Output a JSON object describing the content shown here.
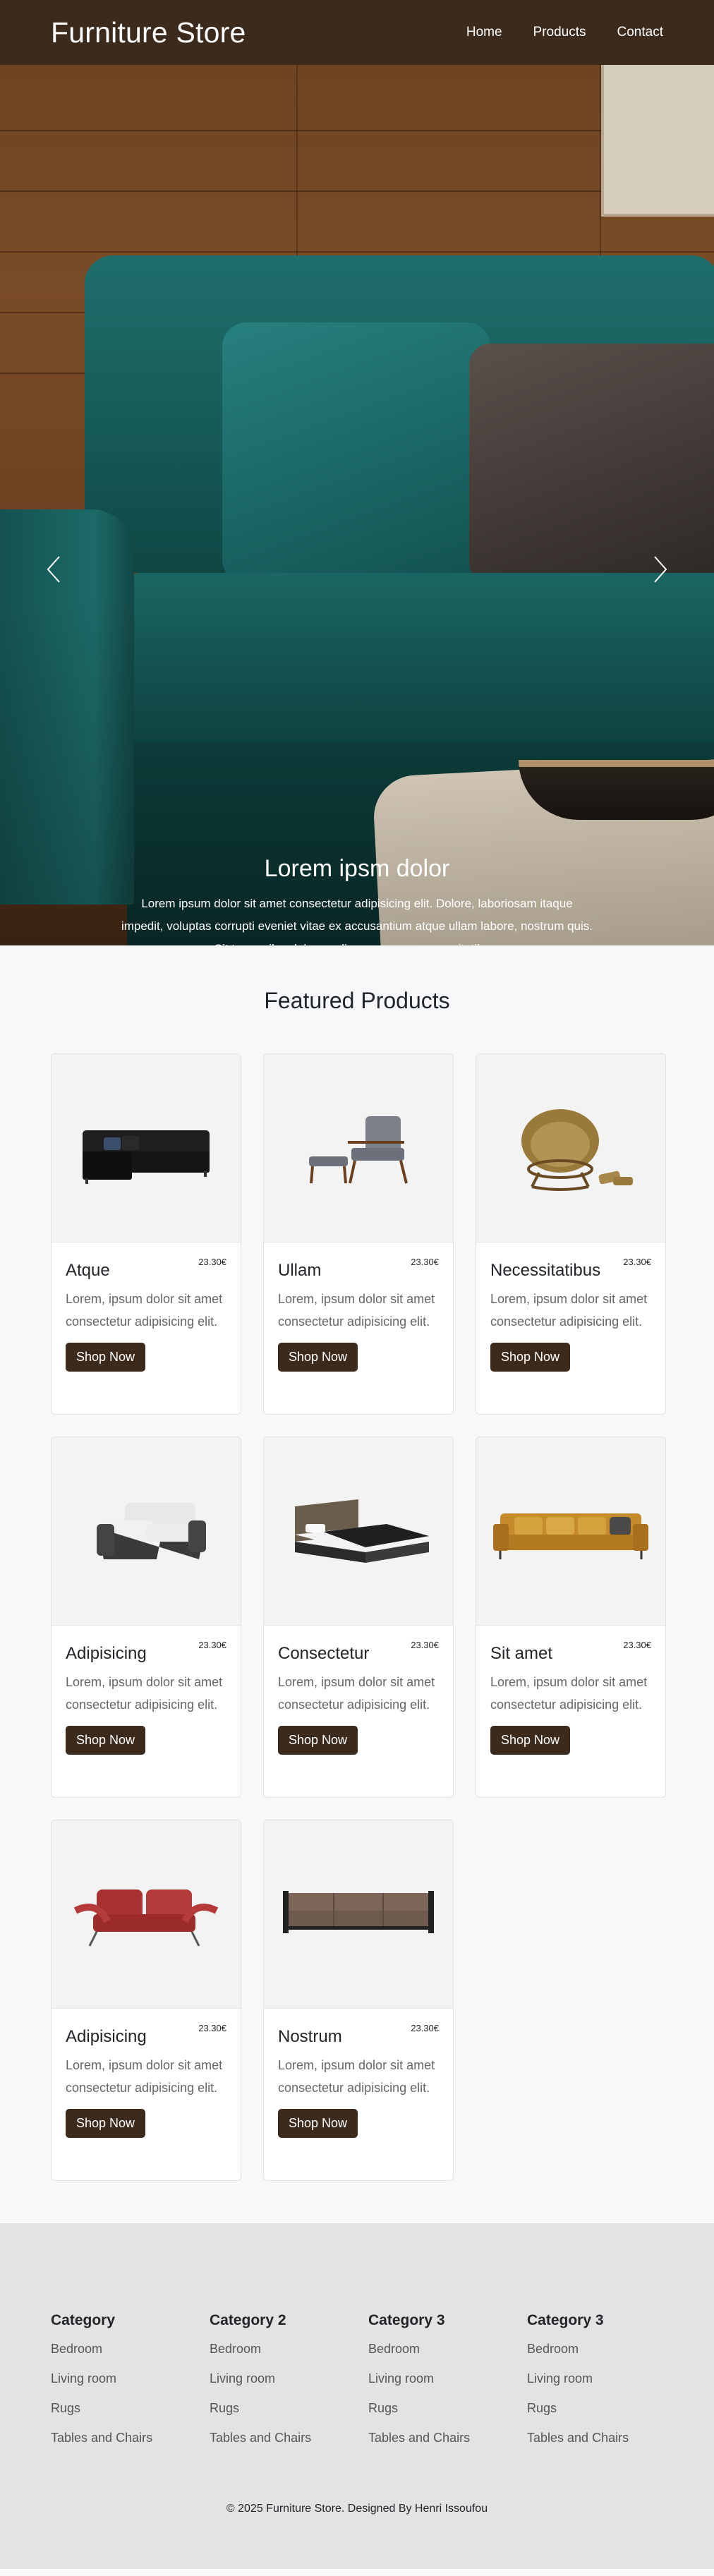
{
  "navbar": {
    "brand": "Furniture Store",
    "links": [
      "Home",
      "Products",
      "Contact"
    ]
  },
  "hero": {
    "title": "Lorem ipsm dolor",
    "text": "Lorem ipsum dolor sit amet consectetur adipisicing elit. Dolore, laboriosam itaque impedit, voluptas corrupti eveniet vitae ex accusantium atque ullam labore, nostrum quis. Sit temporibus labore odio eum eaque necessitatibus.",
    "slides": 3,
    "active_slide": 1
  },
  "products": {
    "section_title": "Featured Products",
    "button_label": "Shop Now",
    "items": [
      {
        "name": "Atque",
        "price": "23.30€",
        "desc": "Lorem, ipsum dolor sit amet consectetur adipisicing elit.",
        "image": "black-sectional-sofa"
      },
      {
        "name": "Ullam",
        "price": "23.30€",
        "desc": "Lorem, ipsum dolor sit amet consectetur adipisicing elit.",
        "image": "armchair-with-ottoman"
      },
      {
        "name": "Necessitatibus",
        "price": "23.30€",
        "desc": "Lorem, ipsum dolor sit amet consectetur adipisicing elit.",
        "image": "papasan-chair"
      },
      {
        "name": "Adipisicing",
        "price": "23.30€",
        "desc": "Lorem, ipsum dolor sit amet consectetur adipisicing elit.",
        "image": "white-wicker-sofa"
      },
      {
        "name": "Consectetur",
        "price": "23.30€",
        "desc": "Lorem, ipsum dolor sit amet consectetur adipisicing elit.",
        "image": "bed"
      },
      {
        "name": "Sit amet",
        "price": "23.30€",
        "desc": "Lorem, ipsum dolor sit amet consectetur adipisicing elit.",
        "image": "mustard-sofa"
      },
      {
        "name": "Adipisicing",
        "price": "23.30€",
        "desc": "Lorem, ipsum dolor sit amet consectetur adipisicing elit.",
        "image": "red-loveseat"
      },
      {
        "name": "Nostrum",
        "price": "23.30€",
        "desc": "Lorem, ipsum dolor sit amet consectetur adipisicing elit.",
        "image": "brown-bench-sofa"
      }
    ]
  },
  "footer": {
    "columns": [
      {
        "title": "Category",
        "links": [
          "Bedroom",
          "Living room",
          "Rugs",
          "Tables and Chairs"
        ]
      },
      {
        "title": "Category 2",
        "links": [
          "Bedroom",
          "Living room",
          "Rugs",
          "Tables and Chairs"
        ]
      },
      {
        "title": "Category 3",
        "links": [
          "Bedroom",
          "Living room",
          "Rugs",
          "Tables and Chairs"
        ]
      },
      {
        "title": "Category 3",
        "links": [
          "Bedroom",
          "Living room",
          "Rugs",
          "Tables and Chairs"
        ]
      }
    ],
    "copyright": "© 2025 Furniture Store. Designed By Henri Issoufou"
  },
  "colors": {
    "brand": "#3c2a1c",
    "footer_bg": "#e3e3e3"
  }
}
